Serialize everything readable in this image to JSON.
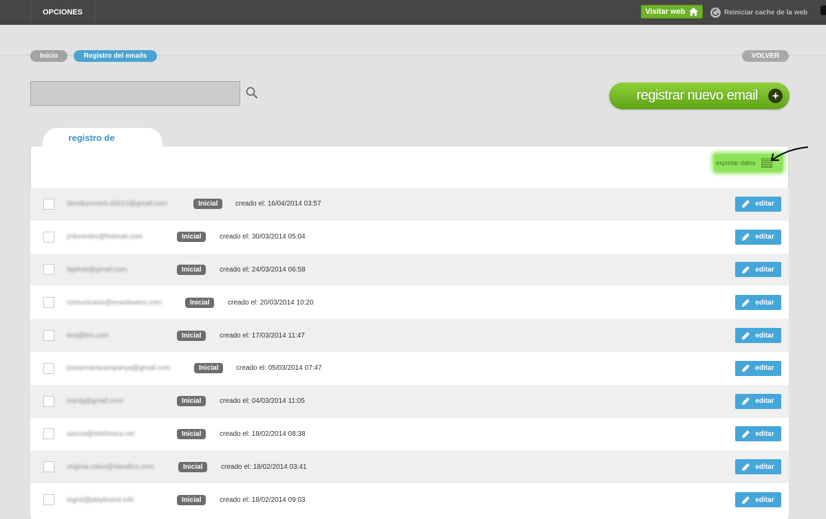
{
  "topbar": {
    "opciones": "OPCIONES",
    "visitar_web": "Visitar web",
    "reiniciar": "Reiniciar cache de la web"
  },
  "breadcrumb": {
    "inicio": "Inicio",
    "current": "Registro del emails",
    "volver": "VOLVER"
  },
  "search": {
    "value": "",
    "placeholder": ""
  },
  "register_button": "registrar nuevo email",
  "tab_label": "registro de",
  "export_label": "exportar datos",
  "icons": {
    "visit": "home-icon",
    "reset": "refresh-icon",
    "search": "search-icon",
    "add": "plus-icon",
    "export": "spreadsheet-icon",
    "edit": "pencil-icon"
  },
  "rows": [
    {
      "email": "davidurrestch.42013@gmail.com",
      "status": "Inicial",
      "created": "creado el: 16/04/2014 03:57",
      "edit": "editar"
    },
    {
      "email": "jmlorentes@hotmail.com",
      "status": "Inicial",
      "created": "creado el: 30/03/2014 05:04",
      "edit": "editar"
    },
    {
      "email": "laptiola@gmail.com",
      "status": "Inicial",
      "created": "creado el: 24/03/2014 06:58",
      "edit": "editar"
    },
    {
      "email": "comunicacio@evaolivares.com",
      "status": "Inicial",
      "created": "creado el: 20/03/2014 10:20",
      "edit": "editar"
    },
    {
      "email": "test@tes.com",
      "status": "Inicial",
      "created": "creado el: 17/03/2014 11:47",
      "edit": "editar"
    },
    {
      "email": "josepmariacampanya@gmail.com",
      "status": "Inicial",
      "created": "creado el: 05/03/2014 07:47",
      "edit": "editar"
    },
    {
      "email": "ivanlg@gmail.com",
      "status": "Inicial",
      "created": "creado el: 04/03/2014 11:05",
      "edit": "editar"
    },
    {
      "email": "asinca@telefonica.net",
      "status": "Inicial",
      "created": "creado el: 18/02/2014 08:38",
      "edit": "editar"
    },
    {
      "email": "virginia.calvo@viandico.com",
      "status": "Inicial",
      "created": "creado el: 18/02/2014 03:41",
      "edit": "editar"
    },
    {
      "email": "ingrid@playbrand.info",
      "status": "Inicial",
      "created": "creado el: 18/02/2014 09:03",
      "edit": "editar"
    }
  ],
  "colors": {
    "accent_blue": "#45a7d9",
    "accent_green": "#6fb22a",
    "badge_grey": "#6d6d6d",
    "topbar": "#464646"
  }
}
